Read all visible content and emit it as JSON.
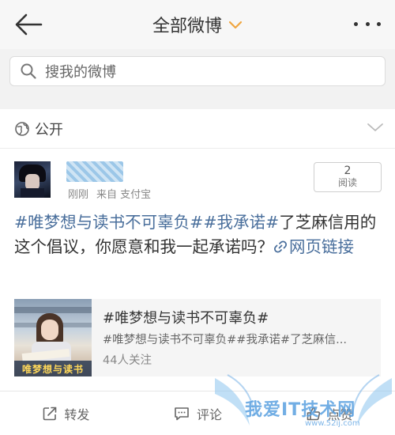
{
  "header": {
    "title": "全部微博",
    "back_icon": "arrow-left-icon",
    "dropdown_icon": "chevron-down-icon",
    "more_icon": "more-dots-icon",
    "accent": "#f0a640"
  },
  "search": {
    "placeholder": "搜我的微博",
    "icon": "search-icon"
  },
  "visibility": {
    "label": "公开",
    "icon": "globe-icon"
  },
  "post": {
    "meta_time": "刚刚",
    "meta_source": "来自 支付宝",
    "read_count": "2",
    "read_label": "阅读",
    "text_tag1": "#唯梦想与读书不可辜负#",
    "text_tag2": "#我承诺#",
    "text_plain": "了芝麻信用的这个倡议，你愿意和我一起承诺吗？",
    "link_label": "网页链接",
    "link_color": "#4a6f9c",
    "card": {
      "title": "#唯梦想与读书不可辜负#",
      "subtitle": "#唯梦想与读书不可辜负##我承诺#了芝麻信...",
      "followers": "44人关注",
      "thumb_text": "唯梦想与读书"
    }
  },
  "actions": {
    "repost": "转发",
    "comment": "评论",
    "like": "点赞"
  },
  "watermark": {
    "text": "我爱IT技术网",
    "sub": "www.52ij.com"
  }
}
